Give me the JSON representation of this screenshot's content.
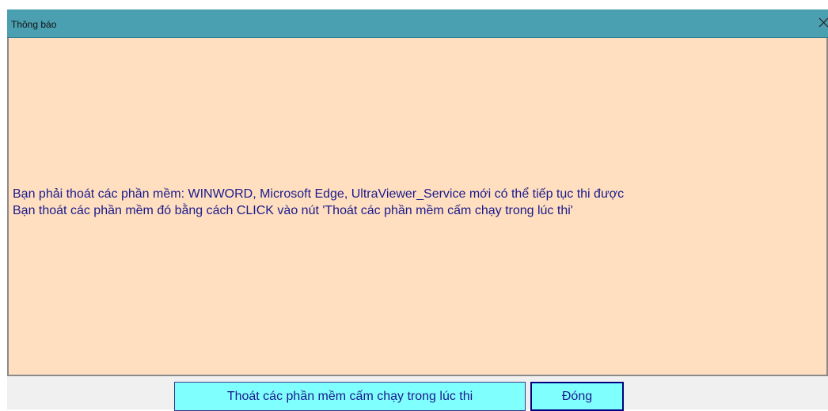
{
  "window": {
    "title": "Thông báo"
  },
  "message": {
    "line1": "Bạn phải thoát các phần mềm: WINWORD, Microsoft Edge, UltraViewer_Service mới có thể tiếp tục thi được",
    "line2": "Bạn thoát các phần mềm đó bằng cách CLICK vào nút 'Thoát các phần mềm cấm chạy trong lúc thi'"
  },
  "buttons": {
    "exit_apps_label": "Thoát các phần mềm cấm chạy trong lúc thi",
    "close_label": "Đóng"
  },
  "icons": {
    "close": "close-icon"
  },
  "colors": {
    "titlebar": "#4a9fb0",
    "content_bg": "#ffdfc0",
    "text": "#1a1a8c",
    "button_bg": "#80ffff",
    "button_border": "#000080"
  }
}
